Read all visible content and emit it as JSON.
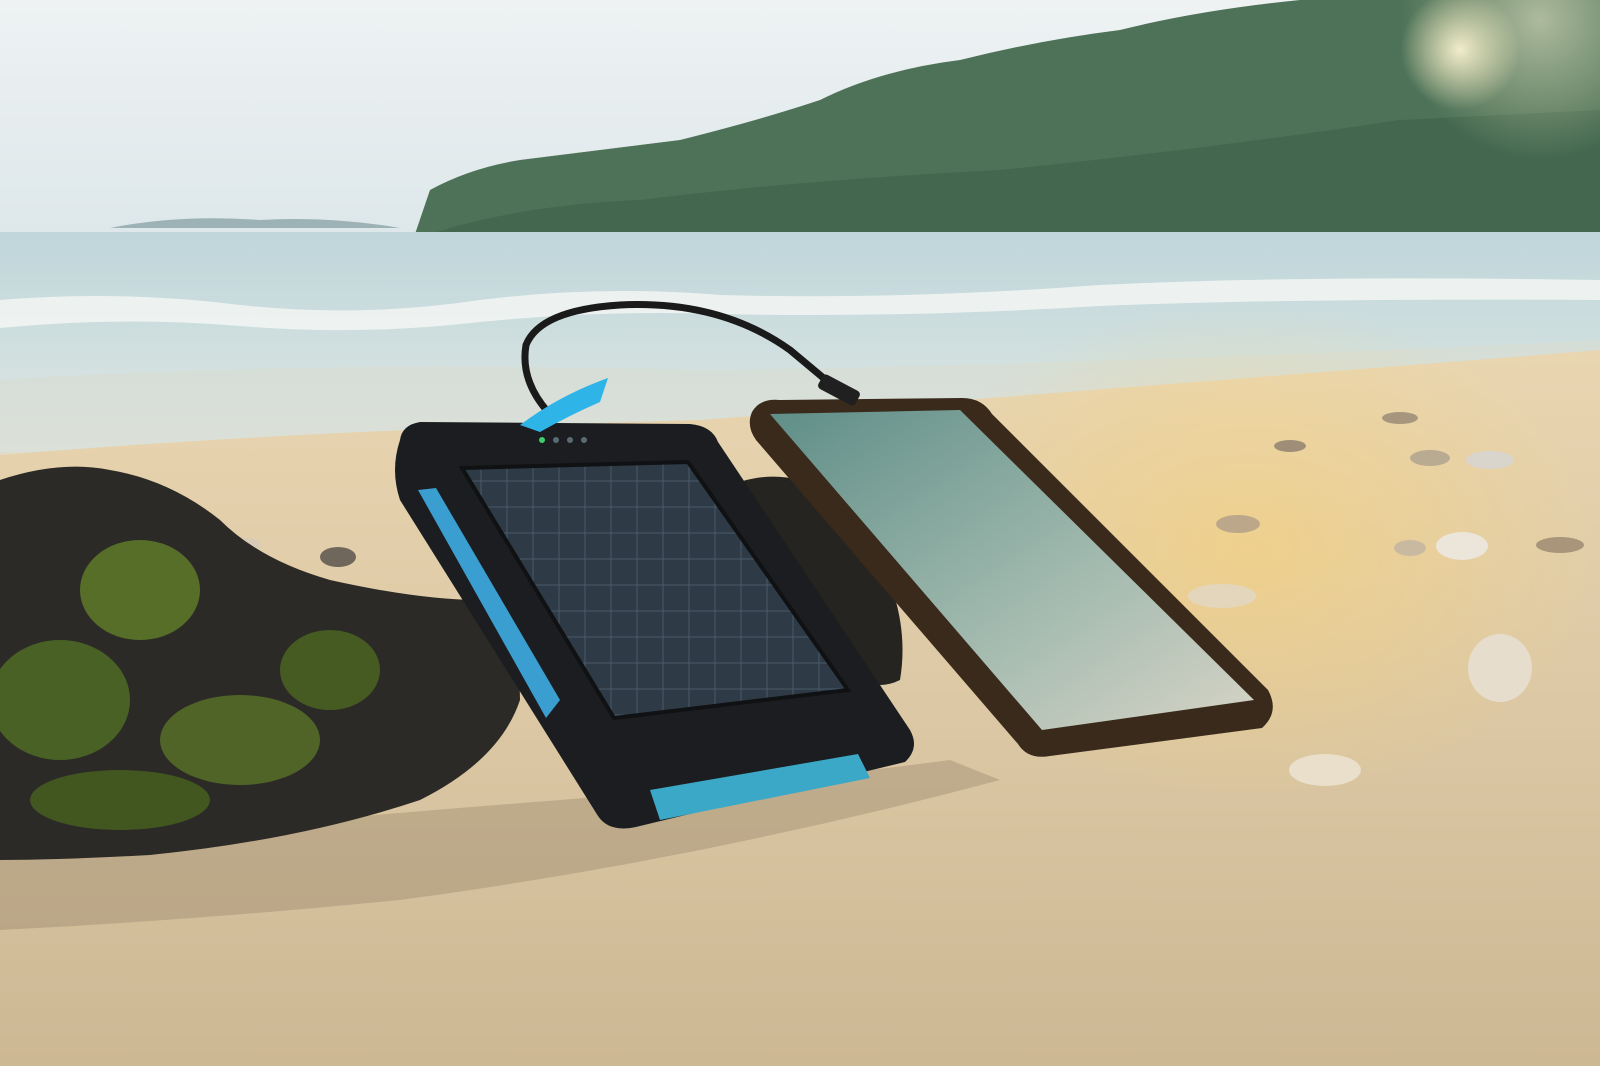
{
  "scene": {
    "subject": "solar-power-bank-charging-smartphone",
    "setting": "tropical-beach",
    "colors": {
      "sky_top": "#eef2f3",
      "sky_bottom": "#dde7ea",
      "hill_far": "#6f8f8a",
      "hill_near": "#3e6a4f",
      "sea": "#cfe0e2",
      "surf": "#f4f7f5",
      "sand_light": "#efe0c2",
      "sand_mid": "#d9c6a3",
      "sand_shadow": "#b8a588",
      "driftwood": "#2c2a26",
      "moss": "#5f7a2a",
      "case_black": "#1b1d20",
      "case_blue": "#3a9fd0",
      "solar_cell": "#2e3a46",
      "phone_frame": "#3a2a1c",
      "phone_screen_top": "#6f9a94",
      "phone_screen_bottom": "#c9cfc6",
      "cable": "#1a1a1a",
      "sun_glow": "#fff3c4"
    },
    "icons": [
      "sun-flare-icon"
    ]
  }
}
